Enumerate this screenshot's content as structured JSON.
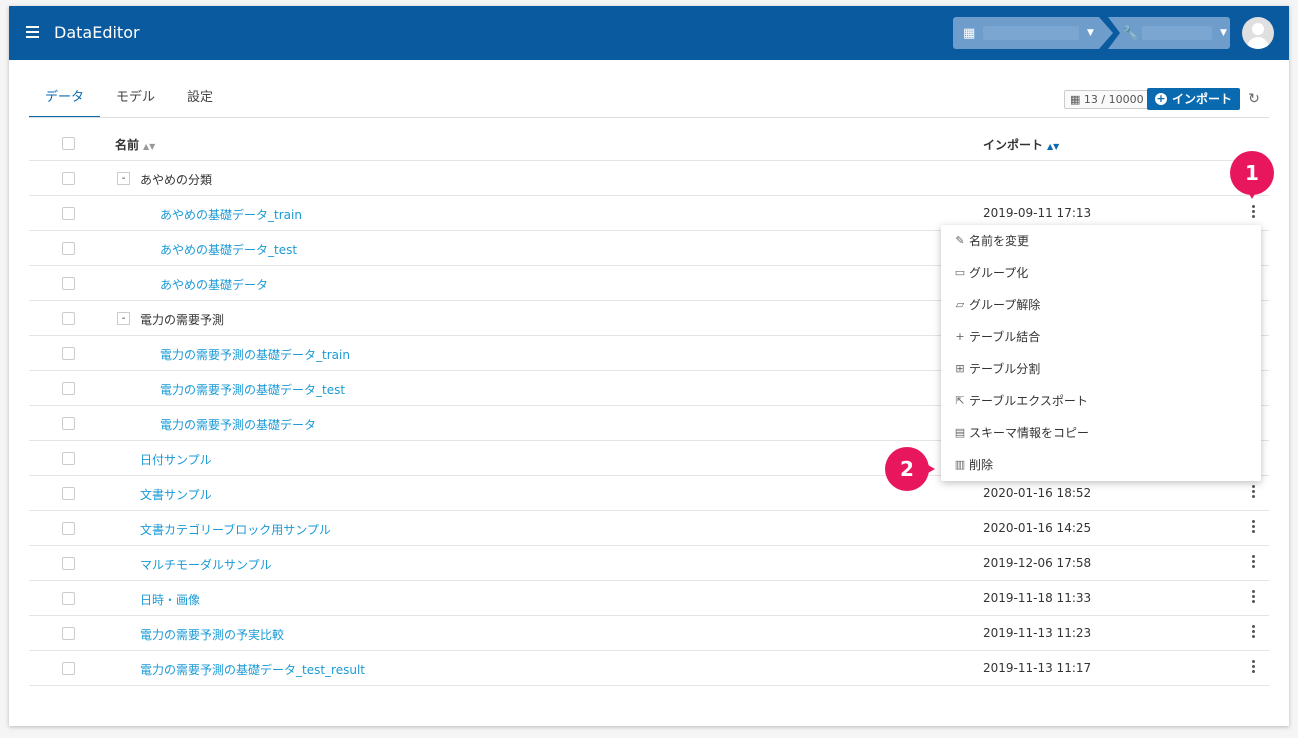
{
  "app": {
    "title": "DataEditor",
    "menu_icon": "hamburger-icon"
  },
  "context": {
    "org_icon": "building-icon",
    "project_icon": "wrench-icon"
  },
  "tabs": [
    {
      "label": "データ",
      "active": true
    },
    {
      "label": "モデル",
      "active": false
    },
    {
      "label": "設定",
      "active": false
    }
  ],
  "toolbar": {
    "quota": "13 / 10000",
    "import_label": "インポート"
  },
  "table": {
    "col_name": "名前",
    "col_import": "インポート",
    "rows": [
      {
        "kind": "group",
        "label": "あやめの分類",
        "toggle": "-"
      },
      {
        "kind": "child",
        "label": "あやめの基礎データ_train",
        "date": "2019-09-11 17:13"
      },
      {
        "kind": "child",
        "label": "あやめの基礎データ_test",
        "date": ""
      },
      {
        "kind": "child",
        "label": "あやめの基礎データ",
        "date": ""
      },
      {
        "kind": "group",
        "label": "電力の需要予測",
        "toggle": "-"
      },
      {
        "kind": "child",
        "label": "電力の需要予測の基礎データ_train",
        "date": ""
      },
      {
        "kind": "child",
        "label": "電力の需要予測の基礎データ_test",
        "date": ""
      },
      {
        "kind": "child",
        "label": "電力の需要予測の基礎データ",
        "date": ""
      },
      {
        "kind": "item",
        "label": "日付サンプル",
        "date": ""
      },
      {
        "kind": "item",
        "label": "文書サンプル",
        "date": "2020-01-16 18:52"
      },
      {
        "kind": "item",
        "label": "文書カテゴリーブロック用サンプル",
        "date": "2020-01-16 14:25"
      },
      {
        "kind": "item",
        "label": "マルチモーダルサンプル",
        "date": "2019-12-06 17:58"
      },
      {
        "kind": "item",
        "label": "日時・画像",
        "date": "2019-11-18 11:33"
      },
      {
        "kind": "item",
        "label": "電力の需要予測の予実比較",
        "date": "2019-11-13 11:23"
      },
      {
        "kind": "item",
        "label": "電力の需要予測の基礎データ_test_result",
        "date": "2019-11-13 11:17"
      }
    ]
  },
  "context_menu": [
    {
      "icon": "✎",
      "icon_name": "pencil-icon",
      "label": "名前を変更"
    },
    {
      "icon": "▭",
      "icon_name": "folder-icon",
      "label": "グループ化"
    },
    {
      "icon": "▱",
      "icon_name": "folder-open-icon",
      "label": "グループ解除"
    },
    {
      "icon": "+",
      "icon_name": "plus-icon",
      "label": "テーブル結合"
    },
    {
      "icon": "⊞",
      "icon_name": "grid-icon",
      "label": "テーブル分割"
    },
    {
      "icon": "⇱",
      "icon_name": "export-icon",
      "label": "テーブルエクスポート"
    },
    {
      "icon": "▤",
      "icon_name": "clipboard-icon",
      "label": "スキーマ情報をコピー"
    },
    {
      "icon": "▥",
      "icon_name": "trash-icon",
      "label": "削除"
    }
  ],
  "callouts": [
    "1",
    "2"
  ],
  "colors": {
    "appbar": "#0a5aa0",
    "link": "#1a9ad6",
    "accent": "#0a6ab0",
    "callout": "#e8175d"
  }
}
